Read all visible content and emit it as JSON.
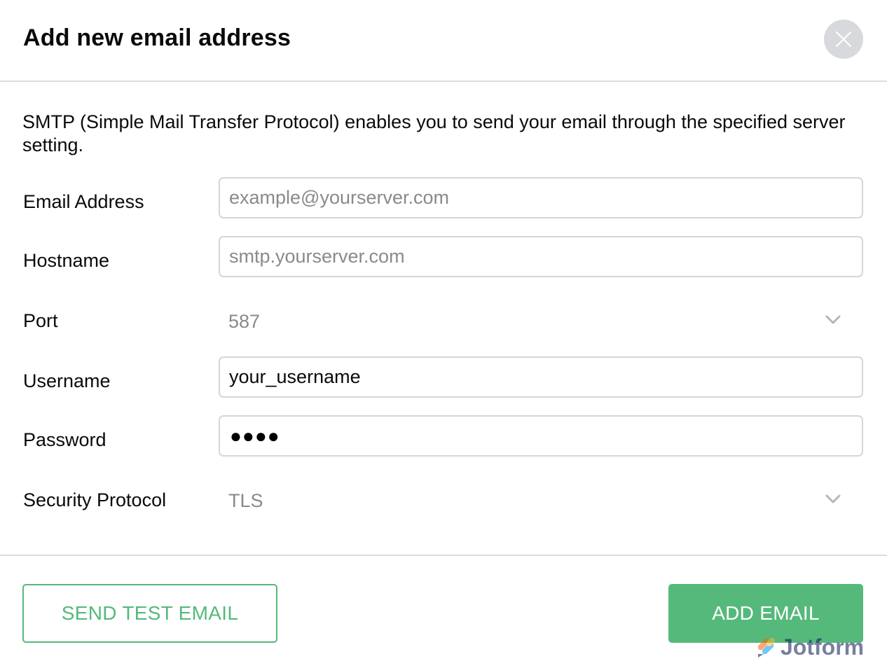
{
  "dialog": {
    "title": "Add new email address",
    "close_icon": "close-icon",
    "description": "SMTP (Simple Mail Transfer Protocol) enables you to send your email through the specified server setting."
  },
  "form": {
    "email": {
      "label": "Email Address",
      "value": "",
      "placeholder": "example@yourserver.com"
    },
    "hostname": {
      "label": "Hostname",
      "value": "",
      "placeholder": "smtp.yourserver.com"
    },
    "port": {
      "label": "Port",
      "selected": "587",
      "icon": "chevron-down-icon"
    },
    "username": {
      "label": "Username",
      "value": "your_username"
    },
    "password": {
      "label": "Password",
      "masked": "●●●●"
    },
    "security": {
      "label": "Security Protocol",
      "selected": "TLS",
      "icon": "chevron-down-icon"
    }
  },
  "footer": {
    "test_label": "SEND TEST EMAIL",
    "add_label": "ADD EMAIL"
  },
  "watermark": {
    "text": "Jotform"
  },
  "colors": {
    "accent": "#55b97b",
    "close_bg": "#d8d9dc",
    "border": "#d6d6d6",
    "placeholder": "#8a8a8a"
  }
}
